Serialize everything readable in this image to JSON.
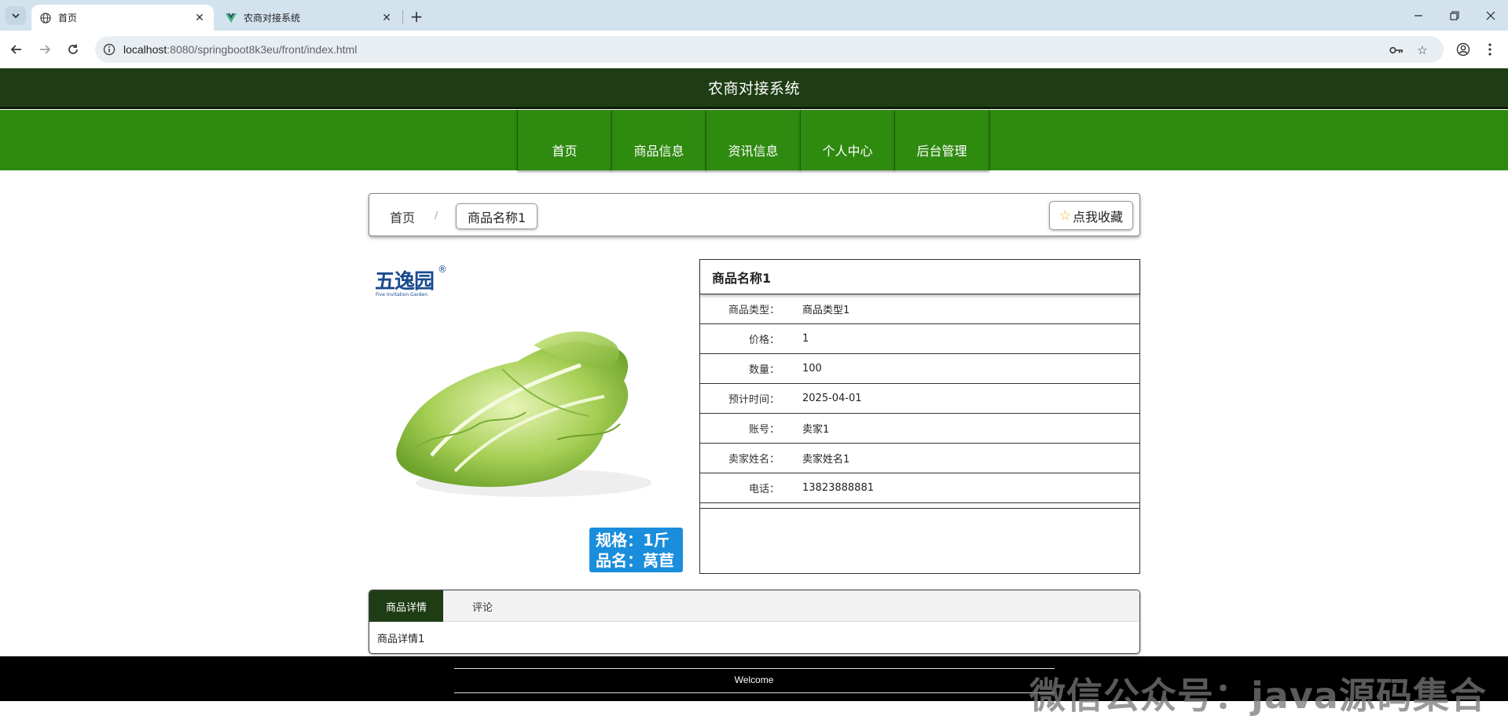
{
  "browser": {
    "tabs": [
      {
        "title": "首页",
        "icon": "globe-icon",
        "active": true
      },
      {
        "title": "农商对接系统",
        "icon": "vue-logo-icon",
        "active": false
      }
    ],
    "url_host": "localhost",
    "url_path": ":8080/springboot8k3eu/front/index.html"
  },
  "site": {
    "title": "农商对接系统",
    "nav": [
      "首页",
      "商品信息",
      "资讯信息",
      "个人中心",
      "后台管理"
    ],
    "colors": {
      "header": "#1f3d14",
      "nav": "#2d8a0e",
      "footer": "#000000"
    }
  },
  "breadcrumb": {
    "home": "首页",
    "separator": "/",
    "current": "商品名称1",
    "favorite": "点我收藏"
  },
  "product": {
    "logo_text": "五逸园",
    "logo_sub": "Five Invitation Garden",
    "logo_reg": "®",
    "badge_line1": "规格：1斤",
    "badge_line2": "品名：莴苣",
    "name": "商品名称1",
    "fields": [
      {
        "label": "商品类型：",
        "value": "商品类型1"
      },
      {
        "label": "价格：",
        "value": "1"
      },
      {
        "label": "数量：",
        "value": "100"
      },
      {
        "label": "预计时间：",
        "value": "2025-04-01"
      },
      {
        "label": "账号：",
        "value": "卖家1"
      },
      {
        "label": "卖家姓名：",
        "value": "卖家姓名1"
      },
      {
        "label": "电话：",
        "value": "13823888881"
      }
    ]
  },
  "detail": {
    "tabs": [
      "商品详情",
      "评论"
    ],
    "content": "商品详情1"
  },
  "footer": {
    "text": "Welcome"
  },
  "watermark": "微信公众号：java源码集合"
}
